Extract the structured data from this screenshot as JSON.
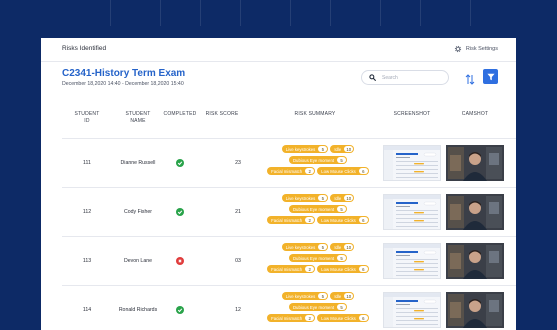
{
  "header": {
    "title": "Risks Identified",
    "settings_label": "Risk Settings"
  },
  "exam": {
    "title": "C2341-History Term Exam",
    "dates": "December 18,2020 14:40 - December 18,2020 15:40"
  },
  "search": {
    "placeholder": "Search"
  },
  "table": {
    "columns": [
      "STUDENT\nID",
      "STUDENT\nNAME",
      "COMPLETED",
      "RISK SCORE",
      "RISK SUMMARY",
      "SCREENSHOT",
      "CAMSHOT"
    ],
    "rows": [
      {
        "id": "111",
        "name": "Dianne Russell",
        "completed": true,
        "score": "23",
        "chips": [
          [
            {
              "label": "Live keystrokes",
              "count": "5"
            },
            {
              "label": "Idle",
              "count": "10"
            }
          ],
          [
            {
              "label": "Dubious Eye moment",
              "count": "5"
            }
          ],
          [
            {
              "label": "Facial mismatch",
              "count": "2"
            },
            {
              "label": "Low Mouse Clicks",
              "count": "6"
            }
          ]
        ]
      },
      {
        "id": "112",
        "name": "Cody Fisher",
        "completed": true,
        "score": "21",
        "chips": [
          [
            {
              "label": "Live keystrokes",
              "count": "5"
            },
            {
              "label": "Idle",
              "count": "10"
            }
          ],
          [
            {
              "label": "Dubious Eye moment",
              "count": "5"
            }
          ],
          [
            {
              "label": "Facial mismatch",
              "count": "2"
            },
            {
              "label": "Low Mouse Clicks",
              "count": "6"
            }
          ]
        ]
      },
      {
        "id": "113",
        "name": "Devon Lane",
        "completed": false,
        "score": "03",
        "chips": [
          [
            {
              "label": "Live keystrokes",
              "count": "5"
            },
            {
              "label": "Idle",
              "count": "10"
            }
          ],
          [
            {
              "label": "Dubious Eye moment",
              "count": "5"
            }
          ],
          [
            {
              "label": "Facial mismatch",
              "count": "2"
            },
            {
              "label": "Low Mouse Clicks",
              "count": "6"
            }
          ]
        ]
      },
      {
        "id": "114",
        "name": "Ronald Richards",
        "completed": true,
        "score": "12",
        "chips": [
          [
            {
              "label": "Live keystrokes",
              "count": "5"
            },
            {
              "label": "Idle",
              "count": "10"
            }
          ],
          [
            {
              "label": "Dubious Eye moment",
              "count": "5"
            }
          ],
          [
            {
              "label": "Facial mismatch",
              "count": "2"
            },
            {
              "label": "Low Mouse Clicks",
              "count": "6"
            }
          ]
        ]
      }
    ]
  },
  "colors": {
    "background": "#0d2a66",
    "accent": "#2f6fe0",
    "title": "#2563c9",
    "chip": "#f2b22a",
    "completed": "#29a34a",
    "incomplete": "#e03c3c"
  },
  "icons": {
    "settings": "gear-icon",
    "search": "search-icon",
    "sort": "sort-arrows-icon",
    "filter": "filter-funnel-icon",
    "completed": "check-circle-icon",
    "incomplete": "x-circle-icon"
  }
}
